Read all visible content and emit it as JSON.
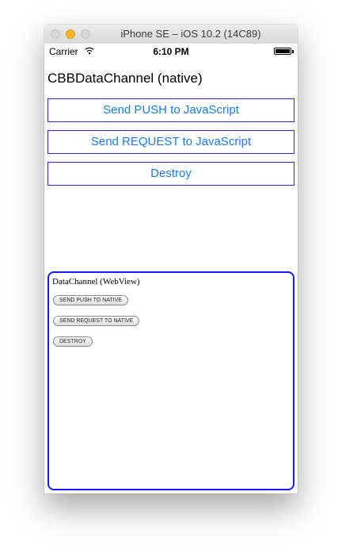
{
  "window": {
    "title": "iPhone SE – iOS 10.2 (14C89)"
  },
  "status_bar": {
    "carrier": "Carrier",
    "time": "6:10 PM"
  },
  "native": {
    "title": "CBBDataChannel (native)",
    "buttons": [
      "Send PUSH to JavaScript",
      "Send REQUEST to JavaScript",
      "Destroy"
    ]
  },
  "webview": {
    "title": "DataChannel (WebView)",
    "buttons": [
      "SEND PUSH TO NATIVE",
      "SEND REQUEST TO NATIVE",
      "DESTROY"
    ]
  },
  "colors": {
    "button_text": "#1c7bf0",
    "button_border": "#2b2bd6",
    "webview_border": "#1a1aff"
  }
}
